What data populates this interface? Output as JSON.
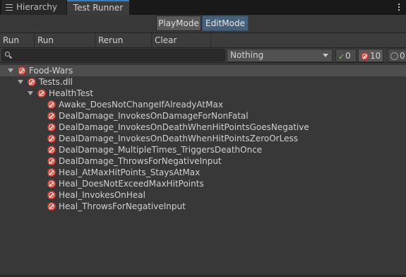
{
  "tabs": [
    {
      "label": "Hierarchy",
      "icon": "list-icon"
    },
    {
      "label": "Test Runner"
    }
  ],
  "modes": {
    "play": "PlayMode",
    "edit": "EditMode",
    "selected": "EditMode"
  },
  "toolbar": {
    "run_all": "Run All",
    "run_selected": "Run Selected",
    "rerun_failed": "Rerun Failed",
    "clear_results": "Clear Results"
  },
  "filter": {
    "search_value": "",
    "category": "Nothing",
    "passed_count": "0",
    "failed_count": "10",
    "not_run_count": "0"
  },
  "tree": {
    "root": {
      "label": "Food-Wars",
      "status": "failed"
    },
    "assembly": {
      "label": "Tests.dll",
      "status": "failed"
    },
    "fixture": {
      "label": "HealthTest",
      "status": "failed"
    },
    "tests": [
      "Awake_DoesNotChangeIfAlreadyAtMax",
      "DealDamage_InvokesOnDamageForNonFatal",
      "DealDamage_InvokesOnDeathWhenHitPointsGoesNegative",
      "DealDamage_InvokesOnDeathWhenHitPointsZeroOrLess",
      "DealDamage_MultipleTimes_TriggersDeathOnce",
      "DealDamage_ThrowsForNegativeInput",
      "Heal_AtMaxHitPoints_StaysAtMax",
      "Heal_DoesNotExceedMaxHitPoints",
      "Heal_InvokesOnHeal",
      "Heal_ThrowsForNegativeInput"
    ]
  },
  "colors": {
    "accent": "#3a79bb",
    "fail": "#c0392b",
    "pass": "#73d15a",
    "edit_mode_bg": "#46607c"
  }
}
